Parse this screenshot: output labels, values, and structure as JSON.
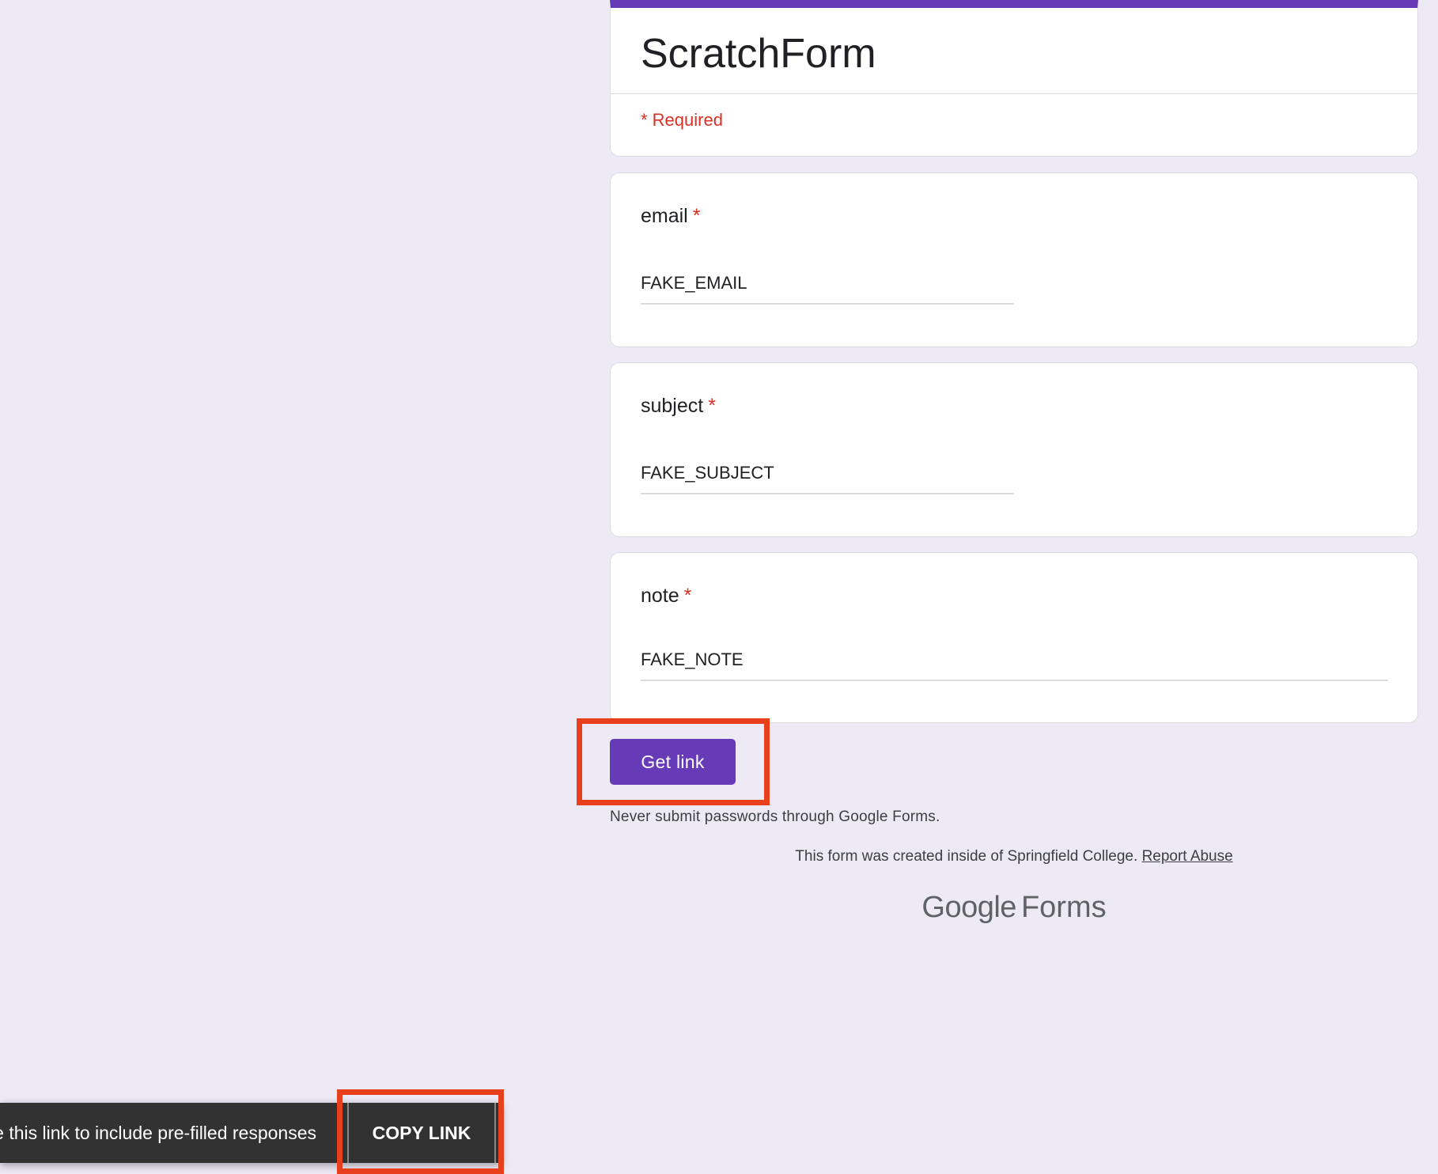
{
  "form": {
    "title": "ScratchForm",
    "required_note": "* Required",
    "accent_color": "#673ab7",
    "required_color": "#d93025"
  },
  "questions": [
    {
      "label": "email",
      "required_mark": "*",
      "value": "FAKE_EMAIL"
    },
    {
      "label": "subject",
      "required_mark": "*",
      "value": "FAKE_SUBJECT"
    },
    {
      "label": "note",
      "required_mark": "*",
      "value": "FAKE_NOTE"
    }
  ],
  "actions": {
    "get_link_label": "Get link"
  },
  "footer": {
    "never_submit": "Never submit passwords through Google Forms.",
    "created_inside": "This form was created inside of Springfield College.",
    "report_abuse": "Report Abuse",
    "brand_google": "Google",
    "brand_forms": "Forms"
  },
  "snackbar": {
    "message": "Share this link to include pre-filled responses",
    "action_label": "COPY LINK"
  },
  "annotations": {
    "highlight_color": "#e8401c"
  }
}
